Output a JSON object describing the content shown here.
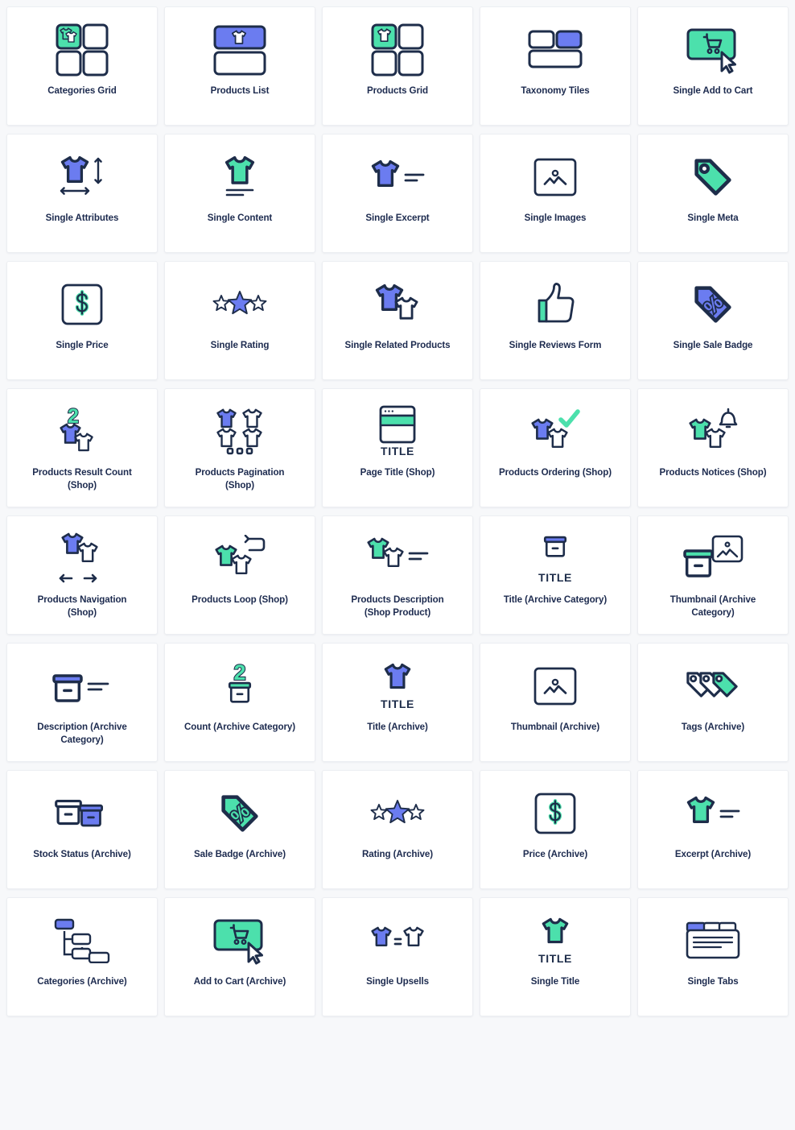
{
  "palette": {
    "background": "#f7f8fa",
    "card_background": "#ffffff",
    "card_border": "#eceef2",
    "label_color": "#1d2b4f",
    "outline": "#1e2d4a",
    "green": "#4ce0ac",
    "blue": "#6b7cf0",
    "white": "#ffffff"
  },
  "grid": {
    "columns": 5,
    "rows": 8,
    "total": 40
  },
  "cards": [
    {
      "label": "Categories Grid",
      "icon": "categories-grid-icon"
    },
    {
      "label": "Products List",
      "icon": "products-list-icon"
    },
    {
      "label": "Products Grid",
      "icon": "products-grid-icon"
    },
    {
      "label": "Taxonomy Tiles",
      "icon": "taxonomy-tiles-icon"
    },
    {
      "label": "Single Add to Cart",
      "icon": "add-to-cart-button-icon"
    },
    {
      "label": "Single Attributes",
      "icon": "shirt-dimensions-icon"
    },
    {
      "label": "Single Content",
      "icon": "shirt-lines-icon"
    },
    {
      "label": "Single Excerpt",
      "icon": "shirt-excerpt-icon"
    },
    {
      "label": "Single Images",
      "icon": "image-frame-icon"
    },
    {
      "label": "Single Meta",
      "icon": "tag-icon"
    },
    {
      "label": "Single Price",
      "icon": "dollar-square-icon"
    },
    {
      "label": "Single Rating",
      "icon": "stars-icon"
    },
    {
      "label": "Single Related Products",
      "icon": "two-shirts-icon"
    },
    {
      "label": "Single Reviews Form",
      "icon": "thumbs-up-icon"
    },
    {
      "label": "Single Sale Badge",
      "icon": "percent-tag-icon"
    },
    {
      "label": "Products Result Count (Shop)",
      "icon": "count-shirts-icon"
    },
    {
      "label": "Products Pagination (Shop)",
      "icon": "shirts-pagination-icon"
    },
    {
      "label": "Page Title (Shop)",
      "icon": "window-title-icon"
    },
    {
      "label": "Products Ordering (Shop)",
      "icon": "shirts-check-icon"
    },
    {
      "label": "Products Notices (Shop)",
      "icon": "shirts-bell-icon"
    },
    {
      "label": "Products Navigation (Shop)",
      "icon": "shirts-arrows-icon"
    },
    {
      "label": "Products Loop (Shop)",
      "icon": "shirts-loop-icon"
    },
    {
      "label": "Products Description (Shop Product)",
      "icon": "shirts-description-icon"
    },
    {
      "label": "Title (Archive Category)",
      "icon": "box-title-icon"
    },
    {
      "label": "Thumbnail (Archive Category)",
      "icon": "box-image-icon"
    },
    {
      "label": "Description (Archive Category)",
      "icon": "box-lines-icon"
    },
    {
      "label": "Count (Archive Category)",
      "icon": "box-count-icon"
    },
    {
      "label": "Title (Archive)",
      "icon": "shirt-title-icon"
    },
    {
      "label": "Thumbnail (Archive)",
      "icon": "image-frame-icon"
    },
    {
      "label": "Tags (Archive)",
      "icon": "three-tags-icon"
    },
    {
      "label": "Stock Status (Archive)",
      "icon": "two-boxes-icon"
    },
    {
      "label": "Sale Badge (Archive)",
      "icon": "percent-tag-green-icon"
    },
    {
      "label": "Rating (Archive)",
      "icon": "stars-icon"
    },
    {
      "label": "Price (Archive)",
      "icon": "dollar-square-icon"
    },
    {
      "label": "Excerpt (Archive)",
      "icon": "shirt-excerpt-green-icon"
    },
    {
      "label": "Categories (Archive)",
      "icon": "tree-nodes-icon"
    },
    {
      "label": "Add to Cart (Archive)",
      "icon": "add-to-cart-button-icon"
    },
    {
      "label": "Single Upsells",
      "icon": "shirts-equals-icon"
    },
    {
      "label": "Single Title",
      "icon": "shirt-title-green-icon"
    },
    {
      "label": "Single Tabs",
      "icon": "tabs-window-icon"
    }
  ]
}
